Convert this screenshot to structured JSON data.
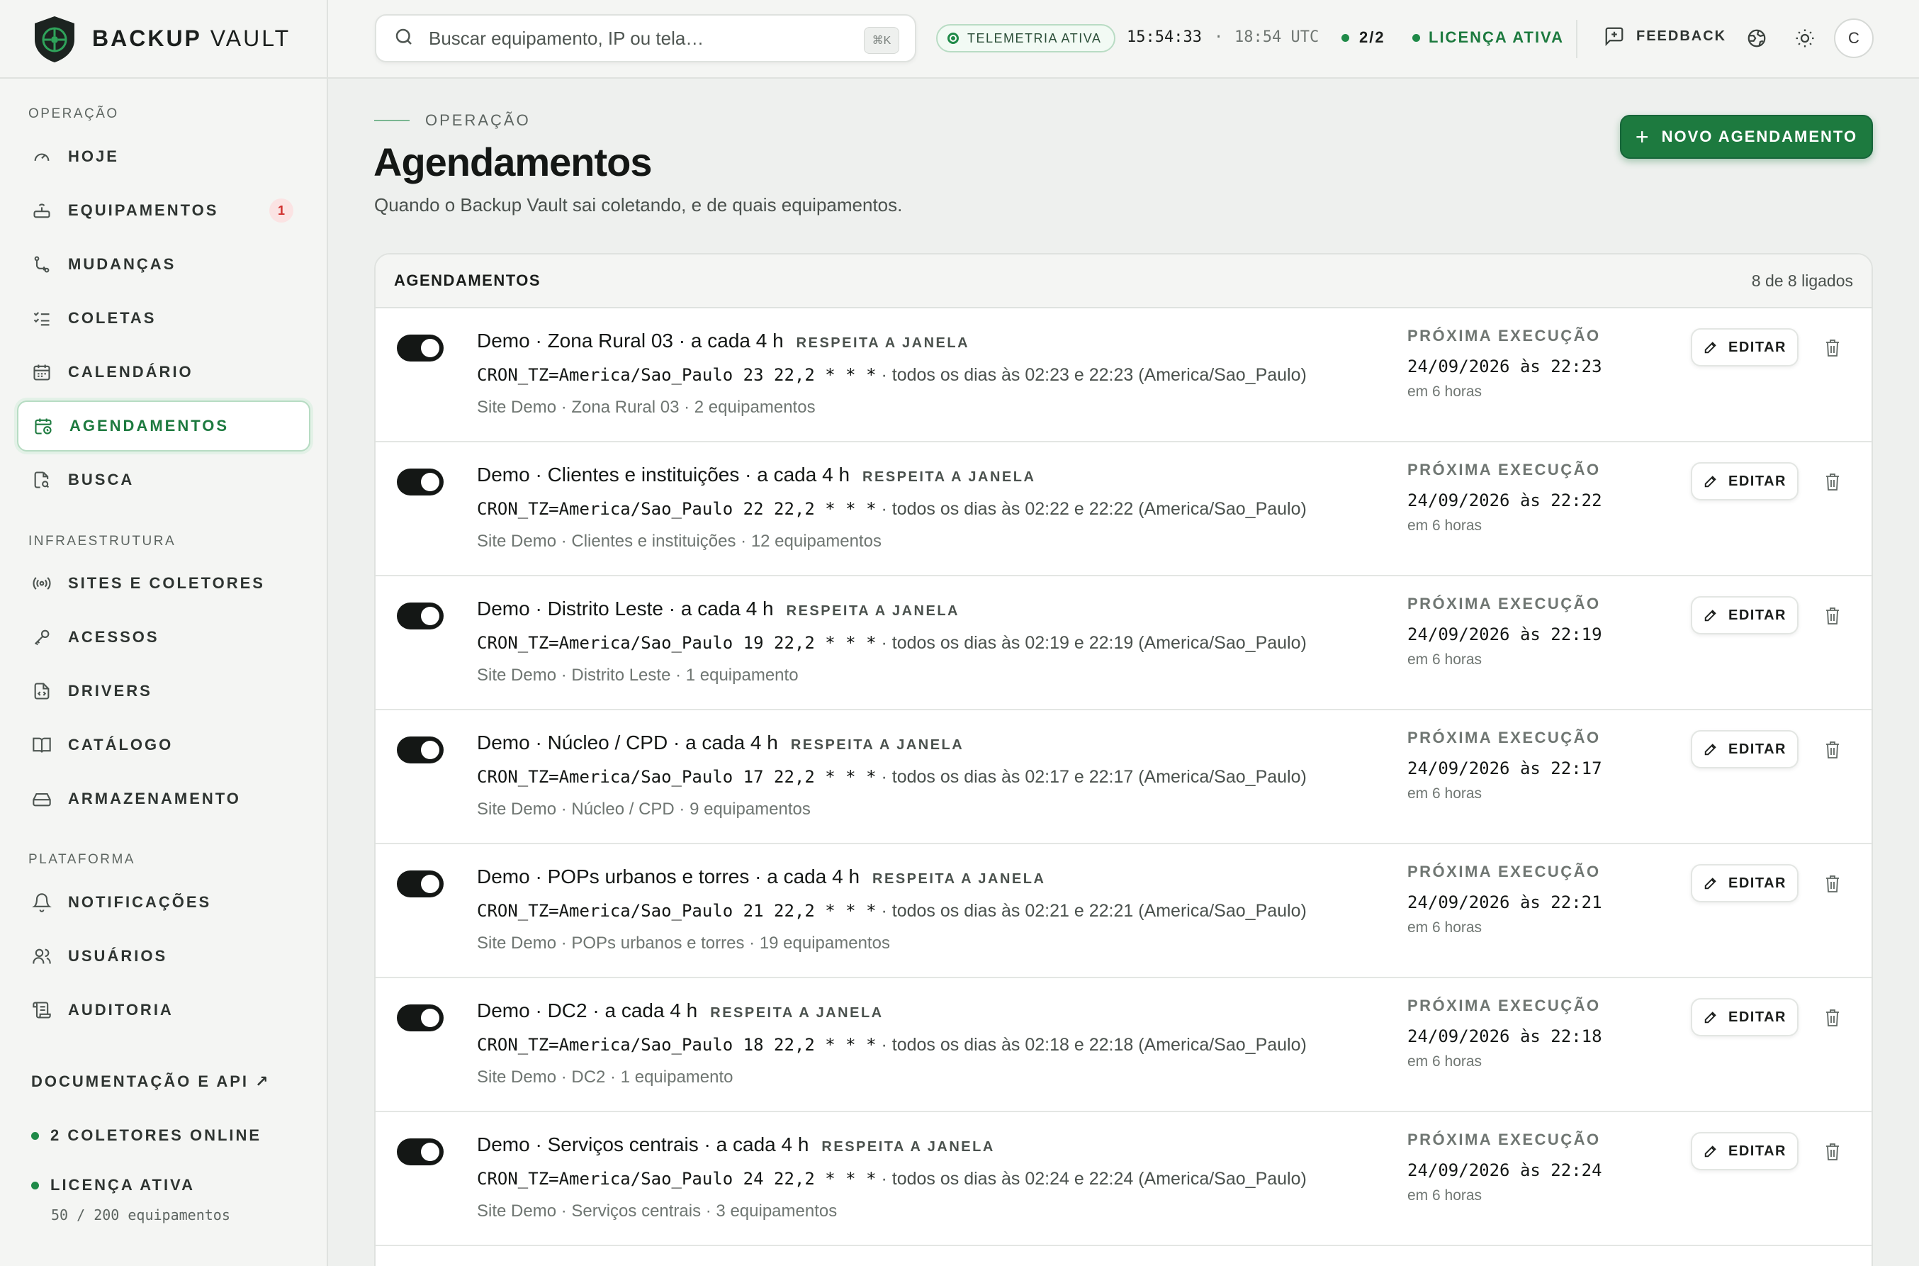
{
  "brand": {
    "name_bold": "BACKUP",
    "name_light": "VAULT"
  },
  "sidebar": {
    "sections": [
      {
        "label": "OPERAÇÃO"
      },
      {
        "label": "INFRAESTRUTURA"
      },
      {
        "label": "PLATAFORMA"
      }
    ],
    "items": [
      {
        "label": "HOJE",
        "icon": "gauge-icon"
      },
      {
        "label": "EQUIPAMENTOS",
        "icon": "router-icon",
        "badge": "1"
      },
      {
        "label": "MUDANÇAS",
        "icon": "git-diff-icon"
      },
      {
        "label": "COLETAS",
        "icon": "list-checks-icon"
      },
      {
        "label": "CALENDÁRIO",
        "icon": "calendar-icon"
      },
      {
        "label": "AGENDAMENTOS",
        "icon": "calendar-clock-icon",
        "active": true
      },
      {
        "label": "BUSCA",
        "icon": "file-search-icon"
      },
      {
        "label": "SITES E COLETORES",
        "icon": "radio-icon"
      },
      {
        "label": "ACESSOS",
        "icon": "key-icon"
      },
      {
        "label": "DRIVERS",
        "icon": "file-code-icon"
      },
      {
        "label": "CATÁLOGO",
        "icon": "book-open-icon"
      },
      {
        "label": "ARMAZENAMENTO",
        "icon": "hard-drive-icon"
      },
      {
        "label": "NOTIFICAÇÕES",
        "icon": "bell-icon"
      },
      {
        "label": "USUÁRIOS",
        "icon": "users-icon"
      },
      {
        "label": "AUDITORIA",
        "icon": "scroll-icon"
      }
    ],
    "docs_link": "DOCUMENTAÇÃO E API ↗",
    "collectors_status": "2 COLETORES ONLINE",
    "license_status": "LICENÇA ATIVA",
    "license_usage": "50 / 200 equipamentos"
  },
  "topbar": {
    "search_placeholder": "Buscar equipamento, IP ou tela…",
    "search_shortcut": "⌘K",
    "telemetry": "TELEMETRIA ATIVA",
    "local_time": "15:54:33",
    "separator": "·",
    "utc_time": "18:54 UTC",
    "collectors": "2/2",
    "license": "LICENÇA ATIVA",
    "feedback": "FEEDBACK",
    "avatar_initial": "C"
  },
  "page": {
    "eyebrow": "OPERAÇÃO",
    "title": "Agendamentos",
    "subtitle": "Quando o Backup Vault sai coletando, e de quais equipamentos.",
    "new_button": "NOVO AGENDAMENTO"
  },
  "card": {
    "title": "AGENDAMENTOS",
    "count": "8 de 8 ligados",
    "next_label": "PRÓXIMA EXECUÇÃO",
    "edit_label": "EDITAR",
    "rows": [
      {
        "title": "Demo · Zona Rural 03 · a cada 4 h",
        "tag": "RESPEITA A JANELA",
        "cron": "CRON_TZ=America/Sao_Paulo 23 22,2 * * *",
        "cron_desc": " · todos os dias às 02:23 e 22:23 (America/Sao_Paulo)",
        "site": "Site Demo · Zona Rural 03 · 2 equipamentos",
        "next": "24/09/2026 às 22:23",
        "rel": "em 6 horas",
        "enabled": true
      },
      {
        "title": "Demo · Clientes e instituições · a cada 4 h",
        "tag": "RESPEITA A JANELA",
        "cron": "CRON_TZ=America/Sao_Paulo 22 22,2 * * *",
        "cron_desc": " · todos os dias às 02:22 e 22:22 (America/Sao_Paulo)",
        "site": "Site Demo · Clientes e instituições · 12 equipamentos",
        "next": "24/09/2026 às 22:22",
        "rel": "em 6 horas",
        "enabled": true
      },
      {
        "title": "Demo · Distrito Leste · a cada 4 h",
        "tag": "RESPEITA A JANELA",
        "cron": "CRON_TZ=America/Sao_Paulo 19 22,2 * * *",
        "cron_desc": " · todos os dias às 02:19 e 22:19 (America/Sao_Paulo)",
        "site": "Site Demo · Distrito Leste · 1 equipamento",
        "next": "24/09/2026 às 22:19",
        "rel": "em 6 horas",
        "enabled": true
      },
      {
        "title": "Demo · Núcleo / CPD · a cada 4 h",
        "tag": "RESPEITA A JANELA",
        "cron": "CRON_TZ=America/Sao_Paulo 17 22,2 * * *",
        "cron_desc": " · todos os dias às 02:17 e 22:17 (America/Sao_Paulo)",
        "site": "Site Demo · Núcleo / CPD · 9 equipamentos",
        "next": "24/09/2026 às 22:17",
        "rel": "em 6 horas",
        "enabled": true
      },
      {
        "title": "Demo · POPs urbanos e torres · a cada 4 h",
        "tag": "RESPEITA A JANELA",
        "cron": "CRON_TZ=America/Sao_Paulo 21 22,2 * * *",
        "cron_desc": " · todos os dias às 02:21 e 22:21 (America/Sao_Paulo)",
        "site": "Site Demo · POPs urbanos e torres · 19 equipamentos",
        "next": "24/09/2026 às 22:21",
        "rel": "em 6 horas",
        "enabled": true
      },
      {
        "title": "Demo · DC2 · a cada 4 h",
        "tag": "RESPEITA A JANELA",
        "cron": "CRON_TZ=America/Sao_Paulo 18 22,2 * * *",
        "cron_desc": " · todos os dias às 02:18 e 22:18 (America/Sao_Paulo)",
        "site": "Site Demo · DC2 · 1 equipamento",
        "next": "24/09/2026 às 22:18",
        "rel": "em 6 horas",
        "enabled": true
      },
      {
        "title": "Demo · Serviços centrais · a cada 4 h",
        "tag": "RESPEITA A JANELA",
        "cron": "CRON_TZ=America/Sao_Paulo 24 22,2 * * *",
        "cron_desc": " · todos os dias às 02:24 e 22:24 (America/Sao_Paulo)",
        "site": "Site Demo · Serviços centrais · 3 equipamentos",
        "next": "24/09/2026 às 22:24",
        "rel": "em 6 horas",
        "enabled": true
      }
    ]
  },
  "colors": {
    "accent": "#1d7a3f",
    "danger": "#d0312f",
    "ok": "#1f8a48"
  }
}
